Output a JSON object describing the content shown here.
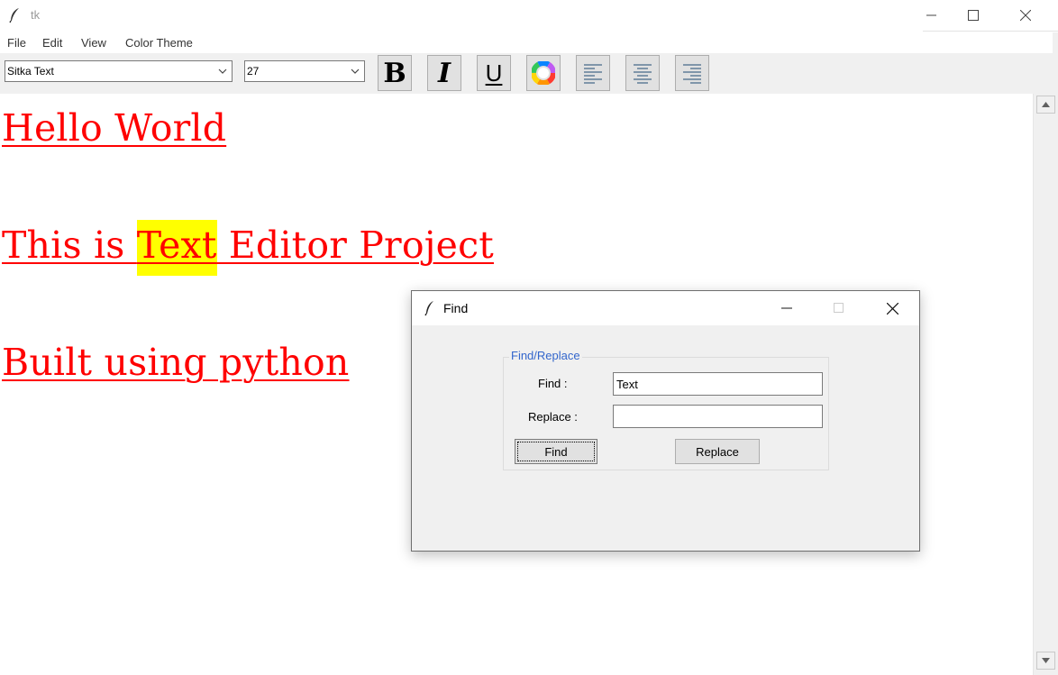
{
  "window": {
    "title": "tk",
    "icon": "feather-icon"
  },
  "menu": {
    "items": [
      "File",
      "Edit",
      "View",
      "Color Theme"
    ]
  },
  "toolbar": {
    "font_family": "Sitka Text",
    "font_size": "27",
    "bold_label": "B",
    "italic_label": "I",
    "underline_label": "U",
    "color_icon": "color-wheel-icon",
    "align_icons": [
      "align-left-icon",
      "align-center-icon",
      "align-right-icon"
    ]
  },
  "document": {
    "line1": "Hello World",
    "line2_before": "This is ",
    "line2_highlight": "Text",
    "line2_after": " Editor Project",
    "line3": "Built using python",
    "text_color": "#ff0000",
    "highlight_color": "#ffff00"
  },
  "dialog": {
    "title": "Find",
    "group_label": "Find/Replace",
    "find_label": "Find :",
    "find_value": "Text",
    "replace_label": "Replace :",
    "replace_value": "",
    "find_button": "Find",
    "replace_button": "Replace"
  }
}
